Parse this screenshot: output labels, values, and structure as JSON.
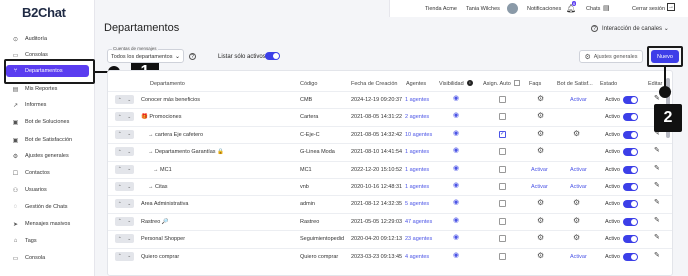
{
  "brand": "B2Chat",
  "sidebar": {
    "items": [
      {
        "label": "Auditoría",
        "icon": "check-circle-icon",
        "glyph": "⊙"
      },
      {
        "label": "Consolas",
        "icon": "monitor-icon",
        "glyph": "▭"
      },
      {
        "label": "Departamentos",
        "icon": "flow-icon",
        "glyph": "⑂"
      },
      {
        "label": "Mis Reportes",
        "icon": "report-icon",
        "glyph": "▤"
      },
      {
        "label": "Informes",
        "icon": "trend-icon",
        "glyph": "↗"
      },
      {
        "label": "Bot de Soluciones",
        "icon": "bot-icon",
        "glyph": "▣"
      },
      {
        "label": "Bot de Satisfacción",
        "icon": "bot-icon",
        "glyph": "▣"
      },
      {
        "label": "Ajustes generales",
        "icon": "gear-icon",
        "glyph": "⚙"
      },
      {
        "label": "Contactos",
        "icon": "contacts-icon",
        "glyph": "☐"
      },
      {
        "label": "Usuarios",
        "icon": "users-icon",
        "glyph": "⚇"
      },
      {
        "label": "Gestión de Chats",
        "icon": "chat-icon",
        "glyph": "◌"
      },
      {
        "label": "Mensajes masivos",
        "icon": "send-icon",
        "glyph": "➤"
      },
      {
        "label": "Tags",
        "icon": "tag-icon",
        "glyph": "⌂"
      },
      {
        "label": "Consola",
        "icon": "console-icon",
        "glyph": "▭"
      }
    ]
  },
  "topbar": {
    "store": "Tienda Acme",
    "user": "Tania Wilches",
    "notifications": "Notificaciones",
    "notif_badge": "6",
    "chats": "Chats",
    "logout": "Cerrar sesión"
  },
  "main": {
    "title": "Departamentos",
    "integration": "Interacción de canales",
    "filter_label": "Cuentas de mensajes",
    "filter_value": "Todos los departamentos",
    "active_only": "Listar sólo activos",
    "settings_button": "Ajustes generales",
    "new_button": "Nuevo"
  },
  "table": {
    "headers": {
      "nombre": "Departamento",
      "codigo": "Código",
      "fecha": "Fecha de Creación",
      "agentes": "Agentes",
      "visibilidad": "Visibilidad",
      "asign": "Asign. Auto",
      "faqs": "Faqs",
      "bot": "Bot de Satisf...",
      "estado": "Estado",
      "editar": "Editar"
    },
    "rows": [
      {
        "name": "Conocer más beneficios",
        "code": "CMB",
        "date": "2024-12-19 09:20:37",
        "agents": "1 agentes",
        "check": false,
        "faq": "gear",
        "bot": "Activar",
        "state": "Activo"
      },
      {
        "name": "🎁 Promociones",
        "code": "Cartera",
        "date": "2021-08-05 14:31:22",
        "agents": "2 agentes",
        "check": false,
        "faq": "gear",
        "bot": "",
        "state": "Activo"
      },
      {
        "name": "→ cartera Eje cafetero",
        "code": "C-Eje-C",
        "date": "2021-08-05 14:32:42",
        "agents": "10 agentes",
        "check": true,
        "faq": "gear",
        "bot": "gear",
        "state": "Activo"
      },
      {
        "name": "→ Departamento Garantías 🔒",
        "code": "G-Linea Moda",
        "date": "2021-08-10 14:41:54",
        "agents": "1 agentes",
        "check": false,
        "faq": "gear",
        "bot": "",
        "state": "Activo"
      },
      {
        "name": "→ MC1",
        "code": "MC1",
        "date": "2022-12-20 15:10:52",
        "agents": "1 agentes",
        "check": false,
        "faq": "Activar",
        "bot": "Activar",
        "state": "Activo"
      },
      {
        "name": "→ Citas",
        "code": "vnb",
        "date": "2020-10-16 12:48:31",
        "agents": "1 agentes",
        "check": false,
        "faq": "Activar",
        "bot": "Activar",
        "state": "Activo"
      },
      {
        "name": "Area Administrativa",
        "code": "admin",
        "date": "2021-08-12 14:32:35",
        "agents": "5 agentes",
        "check": false,
        "faq": "gear",
        "bot": "gear",
        "state": "Activo"
      },
      {
        "name": "Rastreo 🔎",
        "code": "Rastreo",
        "date": "2021-05-05 12:29:03",
        "agents": "47 agentes",
        "check": false,
        "faq": "gear",
        "bot": "gear",
        "state": "Activo"
      },
      {
        "name": "Personal Shopper",
        "code": "Seguimientopedid",
        "date": "2020-04-20 09:12:13",
        "agents": "23 agentes",
        "check": false,
        "faq": "gear",
        "bot": "gear",
        "state": "Activo"
      },
      {
        "name": "Quiero comprar",
        "code": "Quiero comprar",
        "date": "2023-03-23 09:13:45",
        "agents": "4 agentes",
        "check": false,
        "faq": "gear",
        "bot": "Activar",
        "state": "Activo"
      }
    ]
  },
  "callouts": {
    "one": "1",
    "two": "2"
  },
  "colors": {
    "accent": "#5a3df0",
    "primary": "#3d3de8",
    "link": "#4b54e6"
  }
}
